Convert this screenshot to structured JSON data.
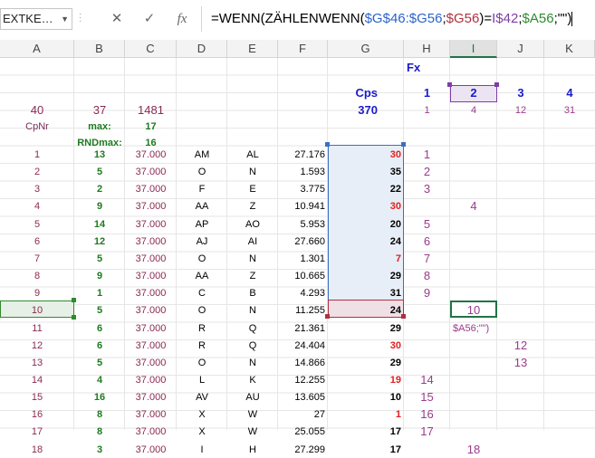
{
  "namebox": "EXTKE…",
  "formula_bar": {
    "cancel_icon": "✕",
    "enter_icon": "✓",
    "fx_icon": "fx",
    "parts": [
      "=WENN(ZÄHLENWENN(",
      "$G$46:$G56",
      ";",
      "$G56",
      ")=",
      "I$42",
      ";",
      "$A56",
      ";\"\")"
    ]
  },
  "columns": [
    "A",
    "B",
    "C",
    "D",
    "E",
    "F",
    "G",
    "H",
    "I",
    "J",
    "K"
  ],
  "header_block": {
    "fx_label": "Fx",
    "cps_label": "Cps",
    "fx_numbers": [
      "1",
      "2",
      "3",
      "4"
    ],
    "row3": {
      "a": "40",
      "b": "37",
      "c": "1481",
      "g": "370",
      "h": "1",
      "i": "4",
      "j": "12",
      "k": "31"
    },
    "row4": {
      "a": "CpNr",
      "b": "max:",
      "c": "17"
    },
    "row5": {
      "b": "RNDmax:",
      "c": "16"
    }
  },
  "rows": [
    {
      "a": "1",
      "b": "13",
      "c": "37.000",
      "d": "AM",
      "e": "AL",
      "f": "27.176",
      "g": "30",
      "gr": true,
      "h": "1",
      "i": "",
      "j": ""
    },
    {
      "a": "2",
      "b": "5",
      "c": "37.000",
      "d": "O",
      "e": "N",
      "f": "1.593",
      "g": "35",
      "gr": false,
      "h": "2",
      "i": "",
      "j": ""
    },
    {
      "a": "3",
      "b": "2",
      "c": "37.000",
      "d": "F",
      "e": "E",
      "f": "3.775",
      "g": "22",
      "gr": false,
      "h": "3",
      "i": "",
      "j": ""
    },
    {
      "a": "4",
      "b": "9",
      "c": "37.000",
      "d": "AA",
      "e": "Z",
      "f": "10.941",
      "g": "30",
      "gr": true,
      "h": "",
      "i": "4",
      "j": ""
    },
    {
      "a": "5",
      "b": "14",
      "c": "37.000",
      "d": "AP",
      "e": "AO",
      "f": "5.953",
      "g": "20",
      "gr": false,
      "h": "5",
      "i": "",
      "j": ""
    },
    {
      "a": "6",
      "b": "12",
      "c": "37.000",
      "d": "AJ",
      "e": "AI",
      "f": "27.660",
      "g": "24",
      "gr": false,
      "h": "6",
      "i": "",
      "j": ""
    },
    {
      "a": "7",
      "b": "5",
      "c": "37.000",
      "d": "O",
      "e": "N",
      "f": "1.301",
      "g": "7",
      "gr": true,
      "h": "7",
      "i": "",
      "j": ""
    },
    {
      "a": "8",
      "b": "9",
      "c": "37.000",
      "d": "AA",
      "e": "Z",
      "f": "10.665",
      "g": "29",
      "gr": false,
      "h": "8",
      "i": "",
      "j": ""
    },
    {
      "a": "9",
      "b": "1",
      "c": "37.000",
      "d": "C",
      "e": "B",
      "f": "4.293",
      "g": "31",
      "gr": false,
      "h": "9",
      "i": "",
      "j": ""
    },
    {
      "a": "10",
      "b": "5",
      "c": "37.000",
      "d": "O",
      "e": "N",
      "f": "11.255",
      "g": "24",
      "gr": false,
      "h": "",
      "i": "10",
      "j": ""
    },
    {
      "a": "11",
      "b": "6",
      "c": "37.000",
      "d": "R",
      "e": "Q",
      "f": "21.361",
      "g": "29",
      "gr": false,
      "h": "",
      "i": "$A56;\"\")",
      "j": ""
    },
    {
      "a": "12",
      "b": "6",
      "c": "37.000",
      "d": "R",
      "e": "Q",
      "f": "24.404",
      "g": "30",
      "gr": true,
      "h": "",
      "i": "",
      "j": "12"
    },
    {
      "a": "13",
      "b": "5",
      "c": "37.000",
      "d": "O",
      "e": "N",
      "f": "14.866",
      "g": "29",
      "gr": false,
      "h": "",
      "i": "",
      "j": "13"
    },
    {
      "a": "14",
      "b": "4",
      "c": "37.000",
      "d": "L",
      "e": "K",
      "f": "12.255",
      "g": "19",
      "gr": true,
      "h": "14",
      "i": "",
      "j": ""
    },
    {
      "a": "15",
      "b": "16",
      "c": "37.000",
      "d": "AV",
      "e": "AU",
      "f": "13.605",
      "g": "10",
      "gr": false,
      "h": "15",
      "i": "",
      "j": ""
    },
    {
      "a": "16",
      "b": "8",
      "c": "37.000",
      "d": "X",
      "e": "W",
      "f": "27",
      "g": "1",
      "gr": true,
      "h": "16",
      "i": "",
      "j": ""
    },
    {
      "a": "17",
      "b": "8",
      "c": "37.000",
      "d": "X",
      "e": "W",
      "f": "25.055",
      "g": "17",
      "gr": false,
      "h": "17",
      "i": "",
      "j": ""
    },
    {
      "a": "18",
      "b": "3",
      "c": "37.000",
      "d": "I",
      "e": "H",
      "f": "27.299",
      "g": "17",
      "gr": false,
      "h": "",
      "i": "18",
      "j": ""
    }
  ],
  "colors": {
    "accent": "#217346",
    "ref_blue": "#2a63c9",
    "ref_purple": "#7e3ea8",
    "ref_red": "#b03040",
    "ref_green": "#2e8b2e"
  }
}
